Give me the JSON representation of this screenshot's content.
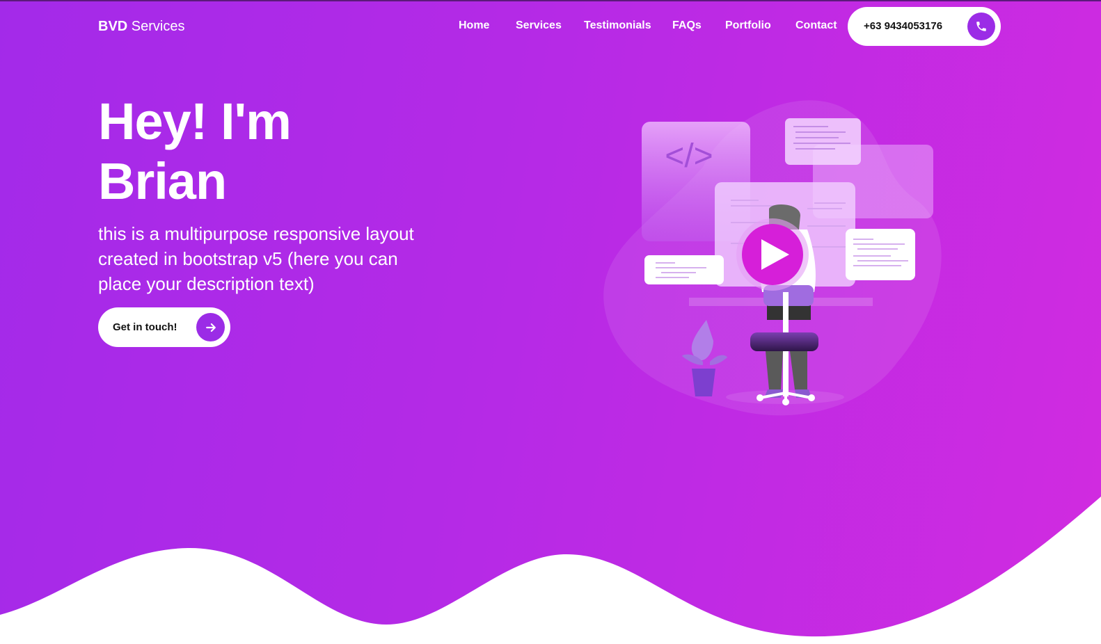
{
  "brand": {
    "bold": "BVD",
    "rest": "Services"
  },
  "nav": {
    "items": [
      "Home",
      "Services",
      "Testimonials",
      "FAQs",
      "Portfolio",
      "Contact"
    ],
    "phone": "+63 9434053176"
  },
  "hero": {
    "title_line1": "Hey! I'm",
    "title_line2": "Brian",
    "description": "this is a multipurpose responsive layout created in bootstrap v5 (here you can place your description text)",
    "cta_label": "Get in touch!"
  },
  "illustration": {
    "code_symbol": "</>"
  },
  "icons": {
    "phone": "phone-icon",
    "arrow": "arrow-right-icon",
    "play": "play-icon"
  },
  "colors": {
    "gradient_start": "#a32ae9",
    "gradient_end": "#d12be0",
    "accent": "#9b2ce6",
    "play": "#d61fd9"
  }
}
